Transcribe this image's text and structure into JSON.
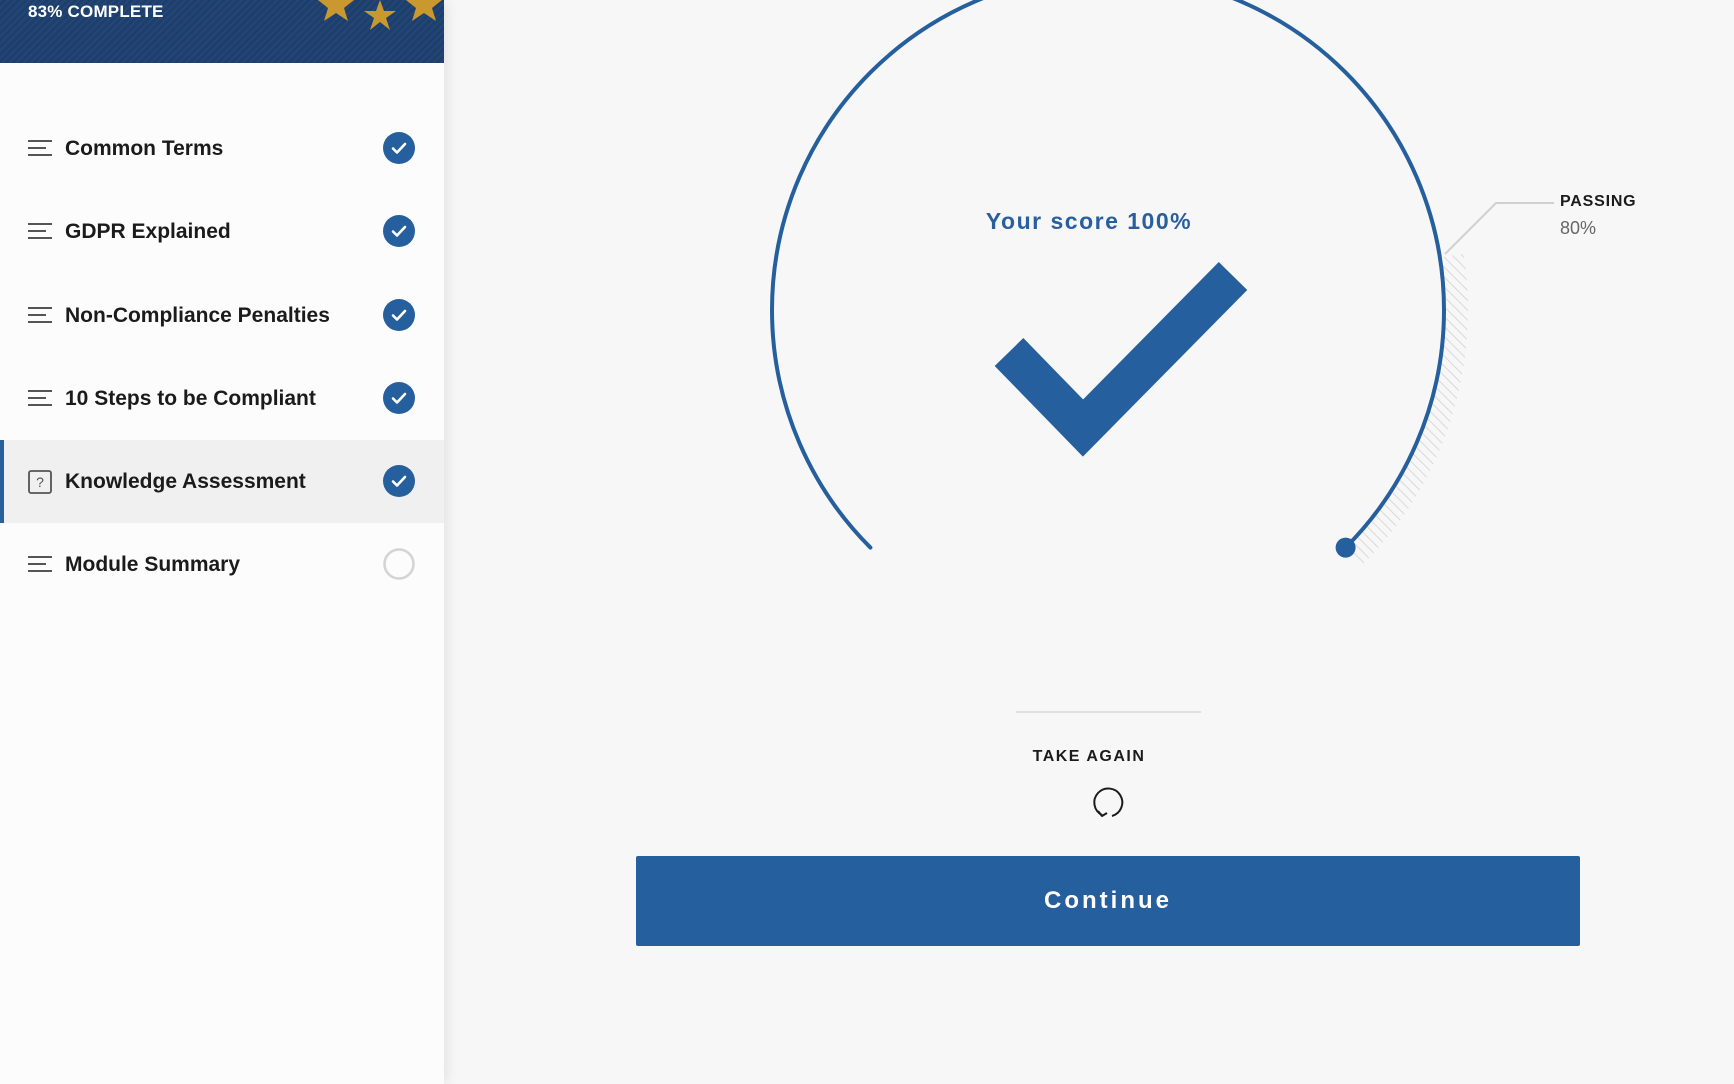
{
  "sidebar": {
    "progress_label": "83% COMPLETE",
    "items": [
      {
        "label": "Common Terms",
        "icon": "lines-icon",
        "status": "complete"
      },
      {
        "label": "GDPR Explained",
        "icon": "lines-icon",
        "status": "complete"
      },
      {
        "label": "Non-Compliance Penalties",
        "icon": "lines-icon",
        "status": "complete"
      },
      {
        "label": "10 Steps to be Compliant",
        "icon": "lines-icon",
        "status": "complete"
      },
      {
        "label": "Knowledge Assessment",
        "icon": "question-icon",
        "status": "complete",
        "active": true
      },
      {
        "label": "Module Summary",
        "icon": "lines-icon",
        "status": "incomplete"
      }
    ]
  },
  "result": {
    "score_text": "Your score 100%",
    "score_percent": 100,
    "passing_label": "PASSING",
    "passing_value": "80%",
    "passing_percent": 80
  },
  "actions": {
    "take_again_label": "TAKE AGAIN",
    "continue_label": "Continue"
  },
  "colors": {
    "accent": "#265f9d",
    "header_bg": "#1d3f6e",
    "star": "#c9982e",
    "incomplete_ring": "#d4d4d4"
  }
}
